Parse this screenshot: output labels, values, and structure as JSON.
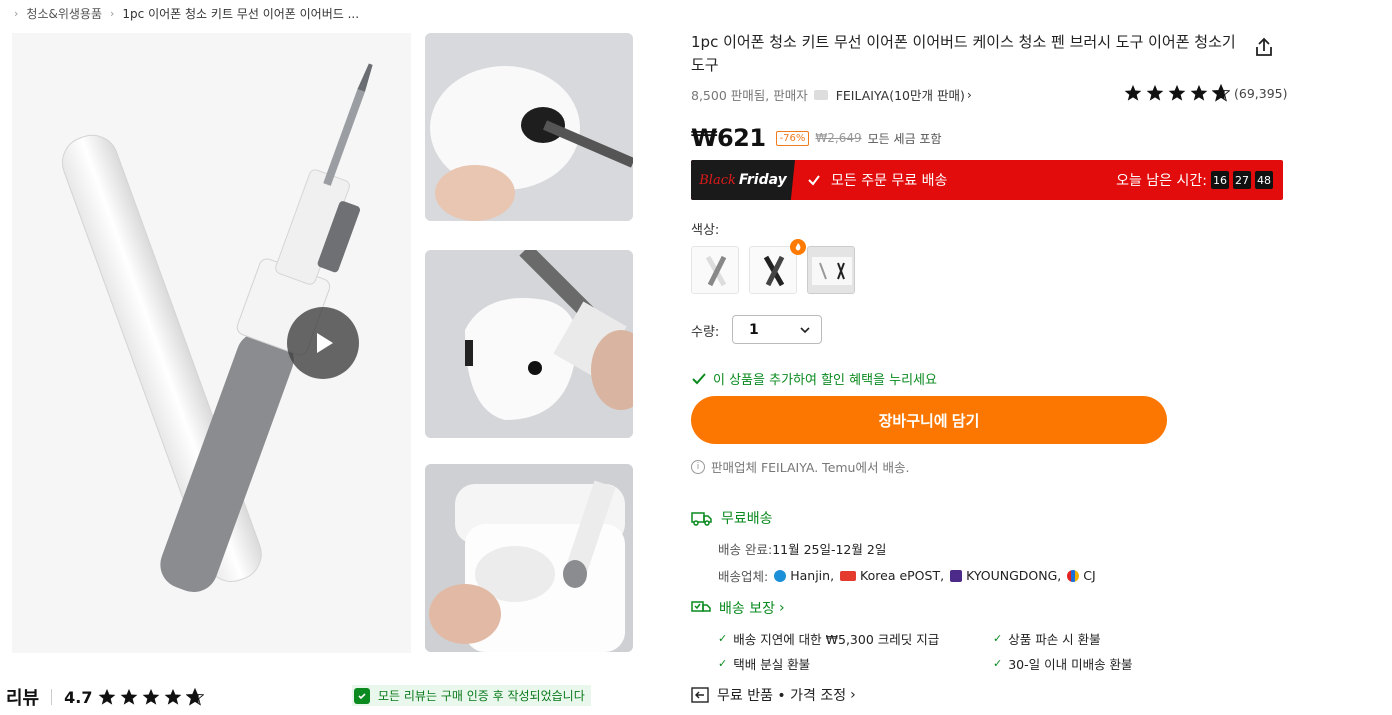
{
  "breadcrumb": {
    "items": [
      "청소&위생용품",
      "1pc 이어폰 청소 키트 무선 이어폰 이어버드 ..."
    ]
  },
  "product": {
    "title": "1pc 이어폰 청소 키트 무선 이어폰 이어버드 케이스 청소 펜 브러시 도구 이어폰 청소기 도구",
    "sales": "8,500 판매됨, 판매자",
    "seller": "FEILAIYA(10만개 판매)",
    "rating_count": "(69,395)",
    "rating_value": 4.7,
    "price": "₩621",
    "discount": "-76%",
    "original_price": "₩2,649",
    "tax_note": "모든 세금 포함"
  },
  "banner": {
    "black": "Black",
    "friday": "Friday",
    "free_shipping": "모든 주문 무료 배송",
    "time_label": "오늘 남은 시간:",
    "hours": "16",
    "minutes": "27",
    "seconds": "48",
    "bg_color": "#e20c0c"
  },
  "options": {
    "color_label": "색상:",
    "qty_label": "수량:",
    "qty_value": "1",
    "bundle_text": "이 상품을 추가하여 할인 혜택을 누리세요"
  },
  "actions": {
    "add_to_cart": "장바구니에 담기",
    "accent": "#fb7701"
  },
  "seller_info": "판매업체 FEILAIYA. Temu에서 배송.",
  "shipping": {
    "title": "무료배송",
    "delivery_label": "배송 완료:",
    "delivery_value": "11월 25일-12월 2일",
    "carrier_label": "배송업체:",
    "carriers": [
      "Hanjin,",
      "Korea ePOST,",
      "KYOUNGDONG,",
      "CJ"
    ]
  },
  "guarantee": {
    "title": "배송 보장",
    "items": [
      "배송 지연에 대한 ₩5,300 크레딧 지급",
      "상품 파손 시 환불",
      "택배 분실 환불",
      "30-일 이내 미배송 환불"
    ]
  },
  "returns": {
    "label": "무료 반품 • 가격 조정"
  },
  "reviews": {
    "title": "리뷰",
    "score": "4.7",
    "verified_text": "모든 리뷰는 구매 인증 후 작성되었습니다"
  }
}
